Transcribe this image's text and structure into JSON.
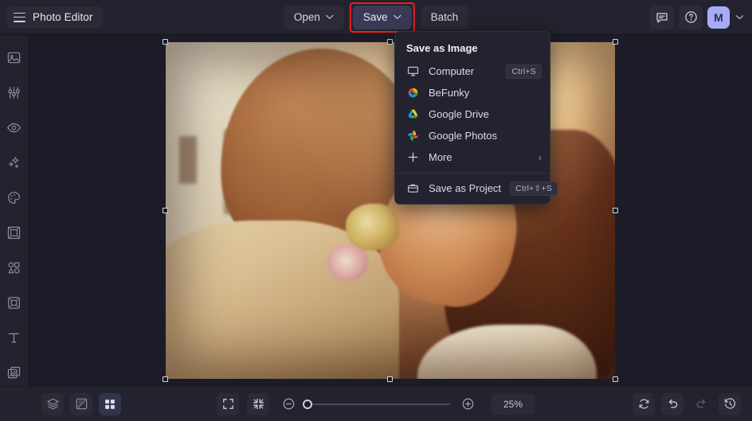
{
  "header": {
    "brand_label": "Photo Editor",
    "menu_icon": "hamburger-icon",
    "open_label": "Open",
    "save_label": "Save",
    "batch_label": "Batch",
    "feedback_icon": "chat-feedback-icon",
    "help_icon": "question-mark-help-icon",
    "avatar_initial": "M",
    "account_caret": "⌄",
    "save_highlight_color": "#ef1e1e",
    "avatar_color": "#a7abf6"
  },
  "save_menu": {
    "title": "Save as Image",
    "items": [
      {
        "label": "Computer",
        "icon": "monitor-icon",
        "shortcut": "Ctrl+S"
      },
      {
        "label": "BeFunky",
        "icon": "befunky-logo-icon",
        "shortcut": ""
      },
      {
        "label": "Google Drive",
        "icon": "google-drive-icon",
        "shortcut": ""
      },
      {
        "label": "Google Photos",
        "icon": "google-photos-icon",
        "shortcut": ""
      },
      {
        "label": "More",
        "icon": "plus-icon",
        "shortcut": "",
        "submenu_arrow": "›"
      }
    ],
    "project_item": {
      "label": "Save as Project",
      "icon": "project-box-icon",
      "shortcut": "Ctrl+⇧+S"
    }
  },
  "sidebar": {
    "items": [
      {
        "name": "edit",
        "icon": "image-edit-icon"
      },
      {
        "name": "touch-up",
        "icon": "sliders-icon"
      },
      {
        "name": "effects-eye",
        "icon": "eye-icon"
      },
      {
        "name": "ai-effects",
        "icon": "sparkles-icon"
      },
      {
        "name": "artsy",
        "icon": "palette-icon"
      },
      {
        "name": "frames",
        "icon": "frame-icon"
      },
      {
        "name": "graphics",
        "icon": "shapes-icon"
      },
      {
        "name": "stickers",
        "icon": "sticker-icon"
      },
      {
        "name": "text",
        "icon": "text-t-icon"
      },
      {
        "name": "overlays",
        "icon": "layers-overlay-icon"
      }
    ]
  },
  "bottom_bar": {
    "left_tools": [
      {
        "name": "layers",
        "icon": "layers-stack-icon",
        "active": false
      },
      {
        "name": "compare",
        "icon": "compare-split-icon",
        "active": false
      },
      {
        "name": "grid",
        "icon": "grid-four-squares-icon",
        "active": true
      }
    ],
    "view_tools": [
      {
        "name": "fullscreen",
        "icon": "expand-fullscreen-icon"
      },
      {
        "name": "fit-to-screen",
        "icon": "collapse-fit-icon"
      }
    ],
    "zoom_out_icon": "minus-circle-icon",
    "zoom_in_icon": "plus-circle-icon",
    "zoom_value": "25%",
    "zoom_slider_percent": 8,
    "right_tools": [
      {
        "name": "reset",
        "icon": "reset-refresh-icon",
        "enabled": true
      },
      {
        "name": "undo",
        "icon": "undo-arrow-icon",
        "enabled": true
      },
      {
        "name": "redo",
        "icon": "redo-arrow-icon",
        "enabled": false
      },
      {
        "name": "history",
        "icon": "history-clock-icon",
        "enabled": true
      }
    ]
  },
  "canvas": {
    "image_description": "Warm sunlit photo of a couple embracing outdoors",
    "selection_handles": 8
  }
}
